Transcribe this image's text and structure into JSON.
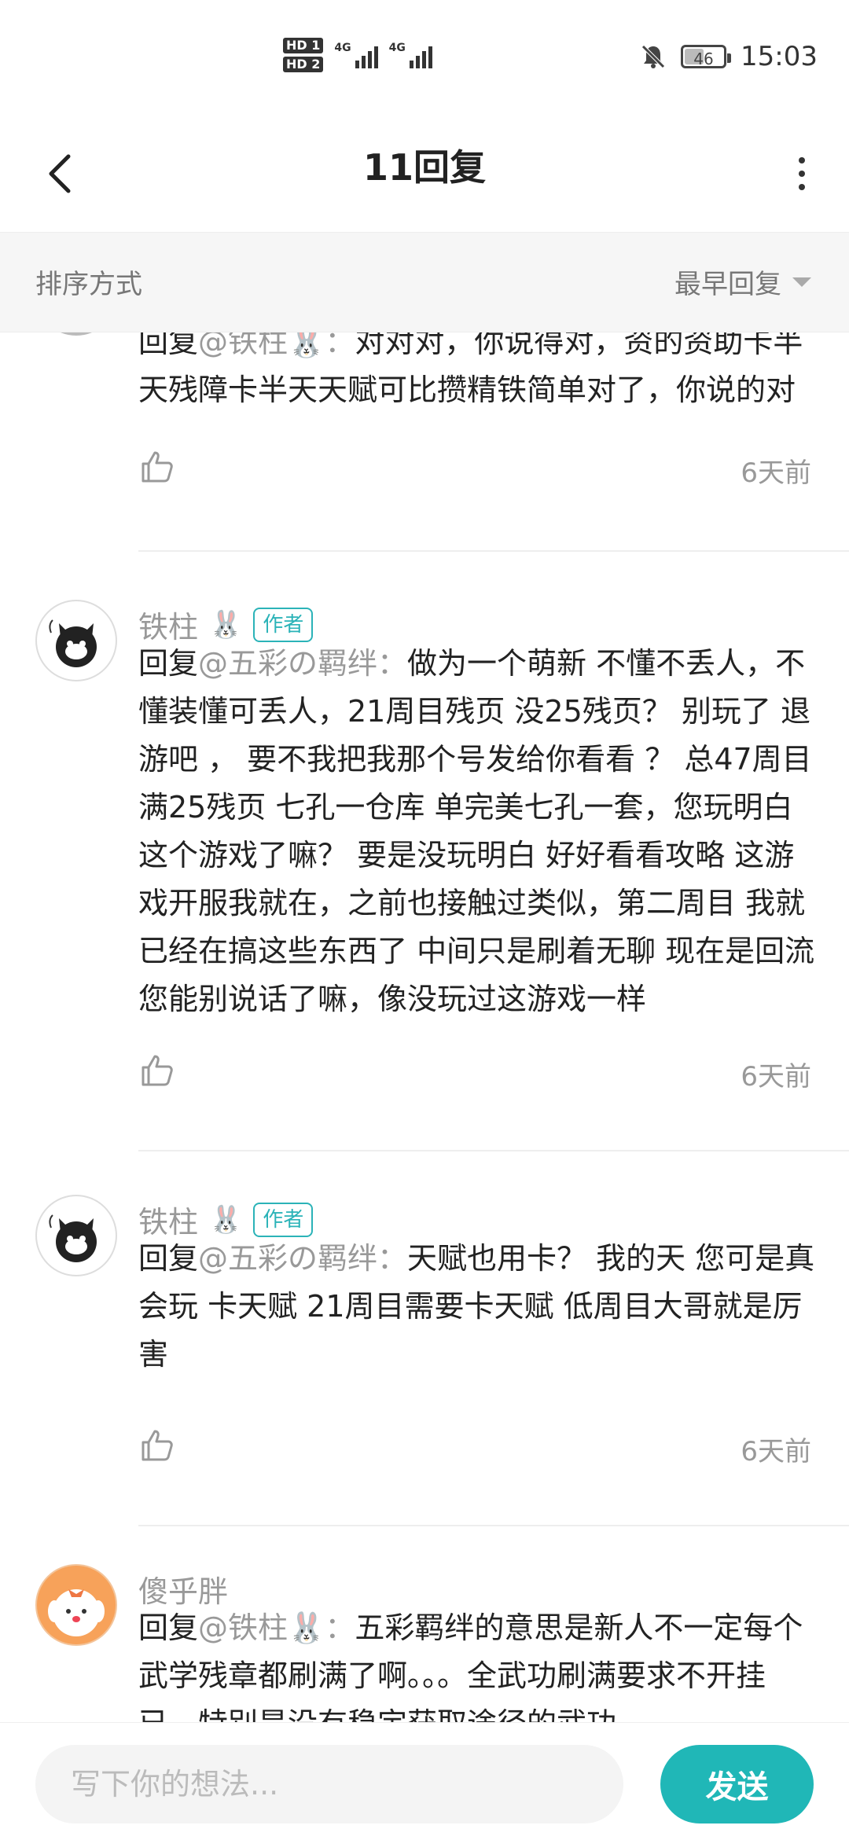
{
  "status_bar": {
    "hd1": "HD 1",
    "hd2": "HD 2",
    "signal1_label": "4G",
    "signal2_label": "4G",
    "battery": "46",
    "time": "15:03",
    "icons": [
      "notifications-off-icon",
      "battery-icon"
    ]
  },
  "header": {
    "title": "11回复",
    "back_icon": "chevron-left-icon",
    "more_icon": "more-vertical-icon"
  },
  "sort": {
    "label": "排序方式",
    "selected": "最早回复"
  },
  "comments": [
    {
      "name": "",
      "is_author": false,
      "reply_prefix": "回复",
      "mention": "@铁柱🐰",
      "colon": "：",
      "text": "对对对，你说得对，资的资助卡半天残障卡半天天赋可比攒精铁简单对了，你说的对",
      "time": "6天前"
    },
    {
      "name": "铁柱",
      "name_emoji": "🐰",
      "is_author": true,
      "author_label": "作者",
      "reply_prefix": "回复",
      "mention": "@五彩の羁绊",
      "colon": "：",
      "text": "做为一个萌新 不懂不丢人，不懂装懂可丢人，21周目残页 没25残页？ 别玩了 退游吧 ， 要不我把我那个号发给你看看 ？ 总47周目 满25残页 七孔一仓库 单完美七孔一套，您玩明白这个游戏了嘛？ 要是没玩明白 好好看看攻略 这游戏开服我就在，之前也接触过类似，第二周目 我就已经在搞这些东西了 中间只是刷着无聊 现在是回流 您能别说话了嘛，像没玩过这游戏一样",
      "time": "6天前"
    },
    {
      "name": "铁柱",
      "name_emoji": "🐰",
      "is_author": true,
      "author_label": "作者",
      "reply_prefix": "回复",
      "mention": "@五彩の羁绊",
      "colon": "：",
      "text": "天赋也用卡？ 我的天  您可是真会玩 卡天赋 21周目需要卡天赋  低周目大哥就是厉害",
      "time": "6天前"
    },
    {
      "name": "傻乎胖",
      "is_author": false,
      "reply_prefix": "回复",
      "mention": "@铁柱🐰",
      "colon": "：",
      "text": "五彩羁绊的意思是新人不一定每个武学残章都刷满了啊。。。全武功刷满要求不开挂已，特别是没有稳定获取途径的武功",
      "time": ""
    }
  ],
  "composer": {
    "placeholder": "写下你的想法...",
    "send_label": "发送"
  },
  "colors": {
    "accent": "#20b7b7",
    "author_badge": "#2bb3b8",
    "muted_text": "#999999"
  }
}
